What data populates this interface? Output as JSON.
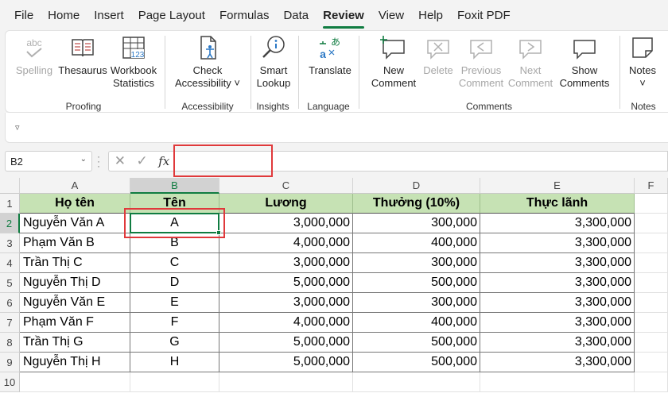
{
  "menu": [
    "File",
    "Home",
    "Insert",
    "Page Layout",
    "Formulas",
    "Data",
    "Review",
    "View",
    "Help",
    "Foxit PDF"
  ],
  "active_tab": "Review",
  "ribbon": {
    "proofing": {
      "label": "Proofing",
      "spelling": "Spelling",
      "thesaurus": "Thesaurus",
      "workbook_stats_1": "Workbook",
      "workbook_stats_2": "Statistics"
    },
    "accessibility": {
      "label": "Accessibility",
      "check_1": "Check",
      "check_2": "Accessibility ˅"
    },
    "insights": {
      "label": "Insights",
      "smart_1": "Smart",
      "smart_2": "Lookup"
    },
    "language": {
      "label": "Language",
      "translate": "Translate"
    },
    "comments": {
      "label": "Comments",
      "new_1": "New",
      "new_2": "Comment",
      "delete": "Delete",
      "prev_1": "Previous",
      "prev_2": "Comment",
      "next_1": "Next",
      "next_2": "Comment",
      "show_1": "Show",
      "show_2": "Comments"
    },
    "notes": {
      "label": "Notes",
      "notes": "Notes",
      "dd": "˅"
    }
  },
  "collapse_caret": "▿",
  "formula_bar": {
    "name_box": "B2",
    "formula": ""
  },
  "columns": [
    "A",
    "B",
    "C",
    "D",
    "E",
    "F"
  ],
  "selected_column": "B",
  "rows": [
    "1",
    "2",
    "3",
    "4",
    "5",
    "6",
    "7",
    "8",
    "9",
    "10"
  ],
  "selected_row": "2",
  "table": {
    "headers": [
      "Họ tên",
      "Tên",
      "Lương",
      "Thưởng (10%)",
      "Thực lãnh"
    ],
    "data": [
      [
        "Nguyễn Văn A",
        "A",
        "3,000,000",
        "300,000",
        "3,300,000"
      ],
      [
        "Phạm Văn B",
        "B",
        "4,000,000",
        "400,000",
        "3,300,000"
      ],
      [
        "Trần Thị C",
        "C",
        "3,000,000",
        "300,000",
        "3,300,000"
      ],
      [
        "Nguyễn Thị D",
        "D",
        "5,000,000",
        "500,000",
        "3,300,000"
      ],
      [
        "Nguyễn Văn E",
        "E",
        "3,000,000",
        "300,000",
        "3,300,000"
      ],
      [
        "Phạm Văn F",
        "F",
        "4,000,000",
        "400,000",
        "3,300,000"
      ],
      [
        "Trần Thị G",
        "G",
        "5,000,000",
        "500,000",
        "3,300,000"
      ],
      [
        "Nguyễn Thị H",
        "H",
        "5,000,000",
        "500,000",
        "3,300,000"
      ]
    ]
  },
  "colors": {
    "accent": "#107c41",
    "header_fill": "#c6e2b4",
    "highlight": "#e0393b"
  },
  "icons": [
    "spelling-icon",
    "thesaurus-icon",
    "workbook-statistics-icon",
    "check-accessibility-icon",
    "smart-lookup-icon",
    "translate-icon",
    "new-comment-icon",
    "delete-comment-icon",
    "previous-comment-icon",
    "next-comment-icon",
    "show-comments-icon",
    "notes-icon",
    "cancel-icon",
    "enter-icon",
    "function-icon"
  ]
}
